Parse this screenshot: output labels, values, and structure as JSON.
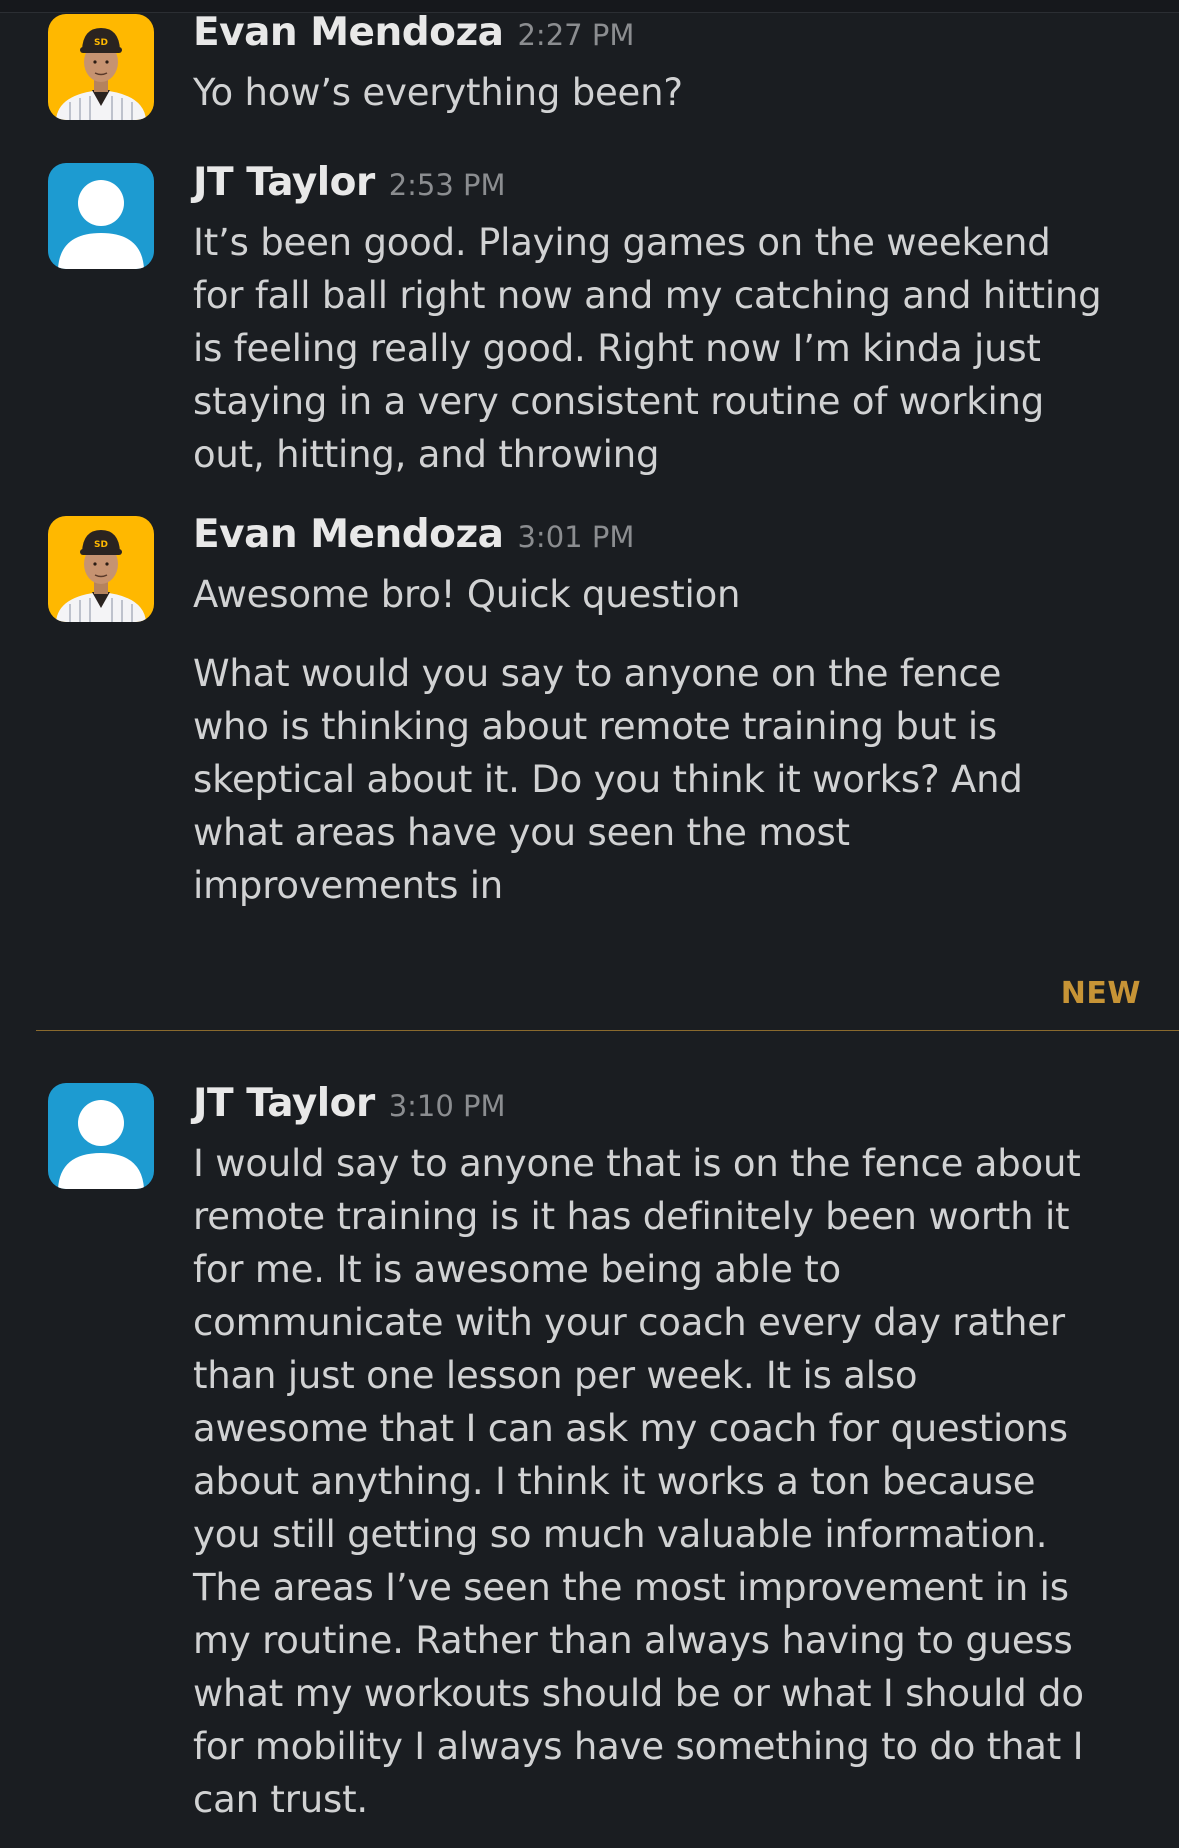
{
  "messages": [
    {
      "sender": "Evan Mendoza",
      "time": "2:27 PM",
      "avatar": "player-photo-avatar",
      "paragraphs": [
        [
          "Yo how’s everything been?"
        ]
      ]
    },
    {
      "sender": "JT Taylor",
      "time": "2:53 PM",
      "avatar": "default-user-avatar",
      "paragraphs": [
        [
          "It’s been good. Playing games on the weekend",
          "for fall ball right now and my catching and hitting",
          "is feeling really good. Right now I’m kinda just",
          "staying in a very consistent routine of working",
          "out, hitting, and throwing"
        ]
      ]
    },
    {
      "sender": "Evan Mendoza",
      "time": "3:01 PM",
      "avatar": "player-photo-avatar",
      "paragraphs": [
        [
          "Awesome bro! Quick question"
        ],
        [
          "What would you say to anyone on the fence",
          "who is thinking about remote training but is",
          "skeptical about it. Do you think it works? And",
          "what areas have you seen the most",
          "improvements in"
        ]
      ]
    },
    {
      "sender": "JT Taylor",
      "time": "3:10 PM",
      "avatar": "default-user-avatar",
      "paragraphs": [
        [
          "I would say to anyone that is on the fence about",
          "remote training is it has definitely been worth it",
          "for me. It is awesome being able to",
          "communicate with your coach every day rather",
          "than just one lesson per week. It is also",
          "awesome that I can ask my coach for questions",
          "about anything. I think it works a ton because",
          "you still getting so much valuable information.",
          "The areas I’ve seen the most improvement in is",
          "my routine. Rather than always having to guess",
          "what my workouts should be or what I should do",
          "for mobility I always have something to do that I",
          "can trust."
        ]
      ]
    }
  ],
  "divider": {
    "label": "NEW"
  },
  "colors": {
    "background": "#1a1d21",
    "text": "#d1d2d3",
    "timestamp": "#8b8d90",
    "new_divider": "#c79436",
    "default_avatar": "#1d9bd1",
    "player_avatar_bg": "#ffb800"
  }
}
